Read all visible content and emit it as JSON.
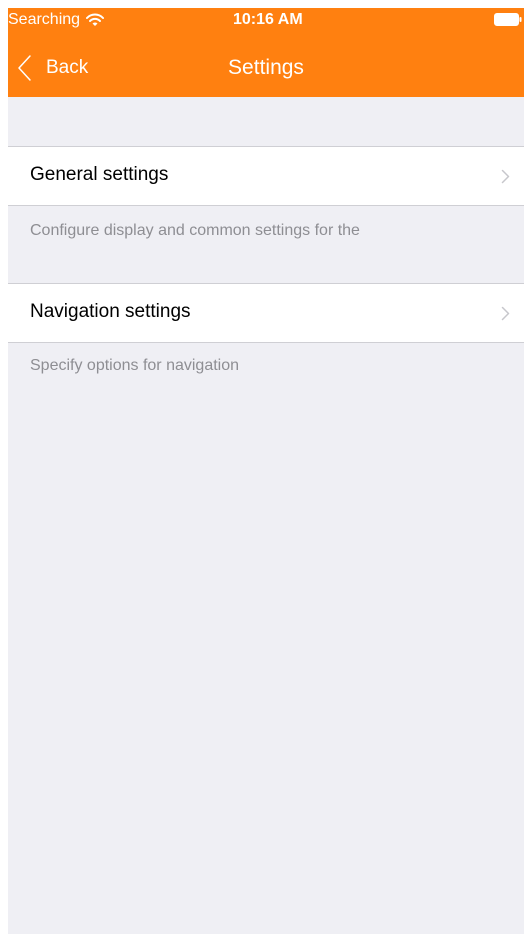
{
  "status_bar": {
    "carrier": "Searching",
    "time": "10:16 AM",
    "wifi_icon": "wifi-icon",
    "battery_icon": "battery-icon"
  },
  "nav_bar": {
    "back_label": "Back",
    "title": "Settings",
    "background_color": "#ff8010"
  },
  "sections": [
    {
      "label": "General settings",
      "footer": "Configure display and common settings for the"
    },
    {
      "label": "Navigation settings",
      "footer": "Specify options for navigation"
    }
  ]
}
